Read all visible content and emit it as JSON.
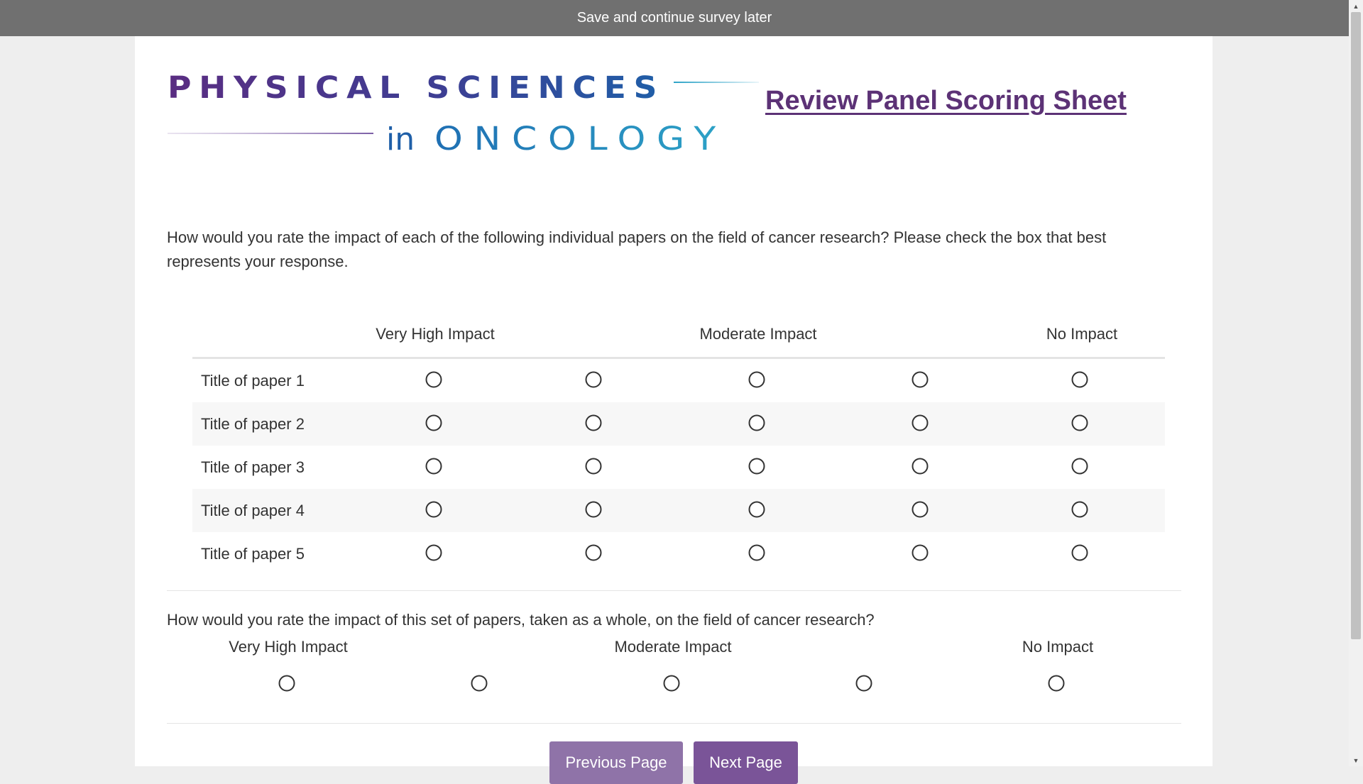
{
  "topbar": {
    "save_label": "Save and continue survey later"
  },
  "logo": {
    "line1": "PHYSICAL SCIENCES",
    "line2_prefix": "in",
    "line2_main": "ONCOLOGY",
    "colors": {
      "purple": "#5a2d82",
      "blue": "#1f5fa8",
      "teal": "#2da3c7"
    }
  },
  "header": {
    "title": "Review Panel Scoring Sheet"
  },
  "question1": {
    "text": "How would you rate the impact of each of the following individual papers on the field of cancer research? Please check the box that best represents your response.",
    "scale_labels": [
      "Very High Impact",
      "Moderate Impact",
      "No Impact"
    ],
    "rows": [
      {
        "label": "Title of paper 1"
      },
      {
        "label": "Title of paper 2"
      },
      {
        "label": "Title of paper 3"
      },
      {
        "label": "Title of paper 4"
      },
      {
        "label": "Title of paper 5"
      }
    ]
  },
  "question2": {
    "text": "How would you rate the impact of this set of papers, taken as a whole, on the field of cancer research?",
    "scale_labels": [
      "Very High Impact",
      "Moderate Impact",
      "No Impact"
    ]
  },
  "navigation": {
    "previous_label": "Previous Page",
    "next_label": "Next Page"
  },
  "colors": {
    "button_prev": "#8f73a8",
    "button_next": "#7a5498",
    "title": "#5c3276",
    "topbar": "#707070"
  }
}
